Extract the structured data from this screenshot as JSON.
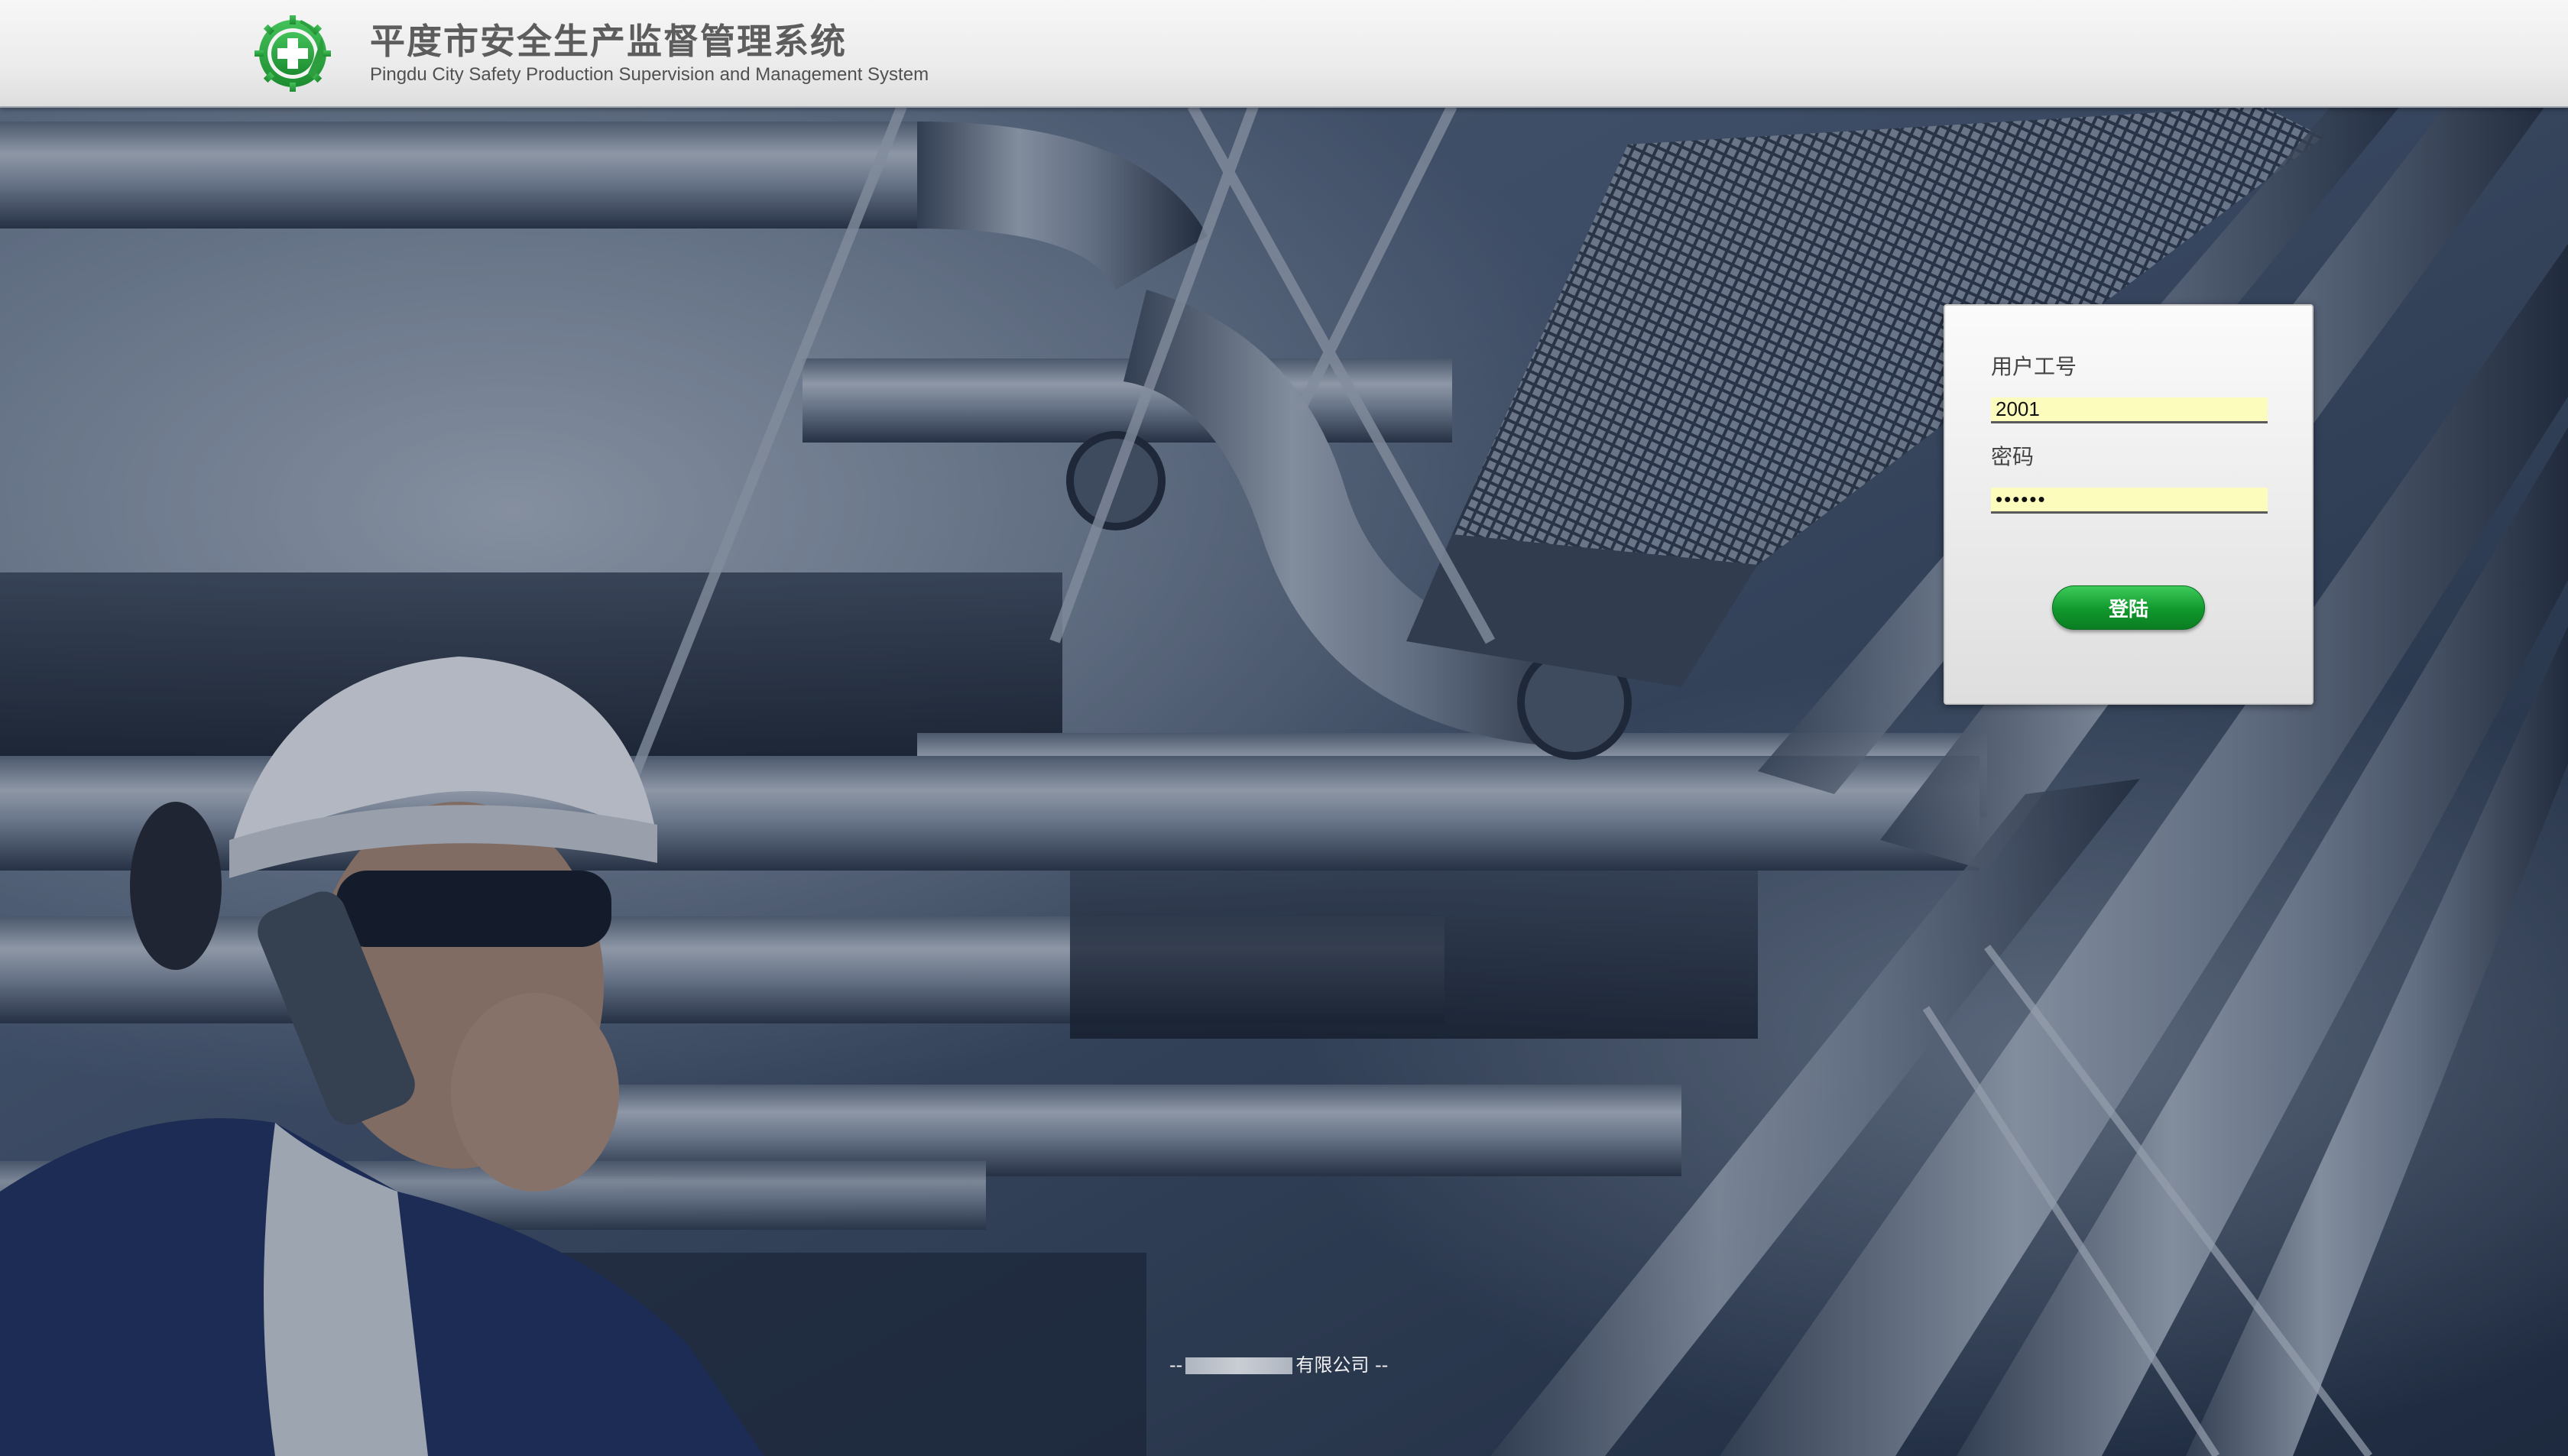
{
  "header": {
    "title_cn": "平度市安全生产监督管理系统",
    "title_en": "Pingdu City Safety Production Supervision and Management System",
    "logo_icon": "safety-cross-gear-icon",
    "logo_color": "#2fa541"
  },
  "login": {
    "username_label": "用户工号",
    "username_value": "2001",
    "password_label": "密码",
    "password_value": "••••••",
    "submit_label": "登陆",
    "input_bg": "#fcfcbd",
    "button_color": "#10972c"
  },
  "footer": {
    "prefix": "--",
    "company_suffix": "有限公司 --"
  }
}
